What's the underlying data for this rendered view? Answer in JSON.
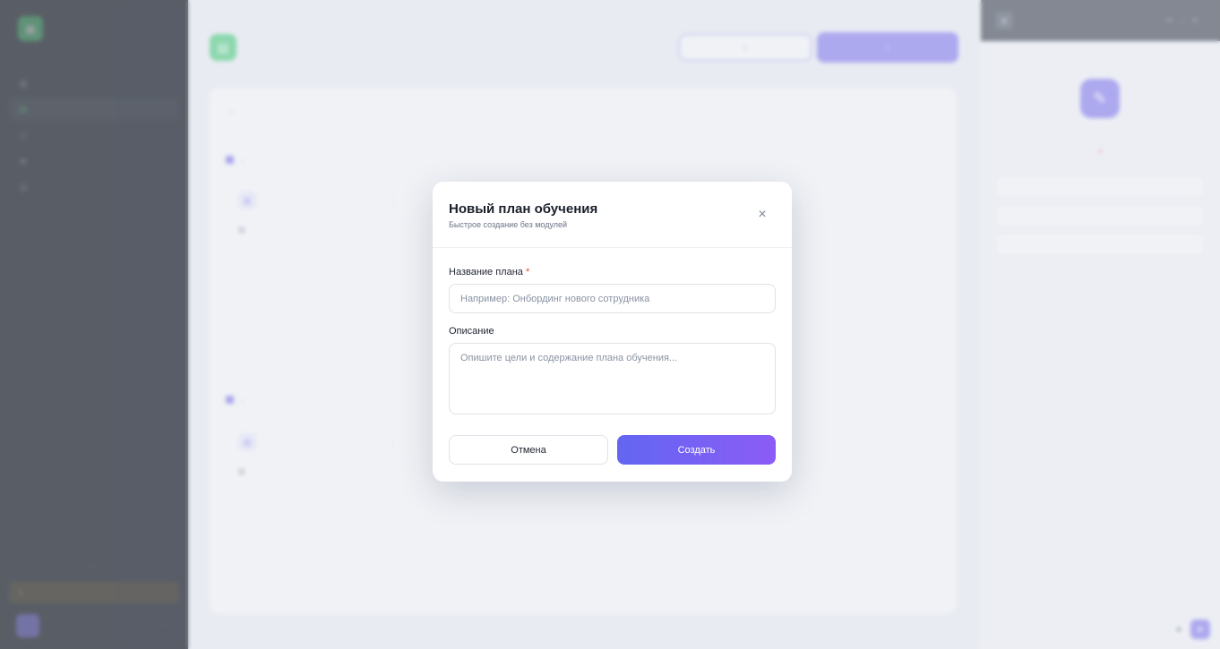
{
  "colors": {
    "accent": "#6c5df0",
    "brand_green": "#22c55e",
    "required": "#ef4444"
  },
  "modal": {
    "title": "Новый план обучения",
    "subtitle": "Быстрое создание без модулей",
    "name_label": "Название плана",
    "required_mark": "*",
    "name_placeholder": "Например: Онбординг нового сотрудника",
    "name_value": "",
    "description_label": "Описание",
    "description_placeholder": "Опишите цели и содержание плана обучения...",
    "description_value": "",
    "cancel_label": "Отмена",
    "submit_label": "Создать",
    "close_icon": "×"
  }
}
